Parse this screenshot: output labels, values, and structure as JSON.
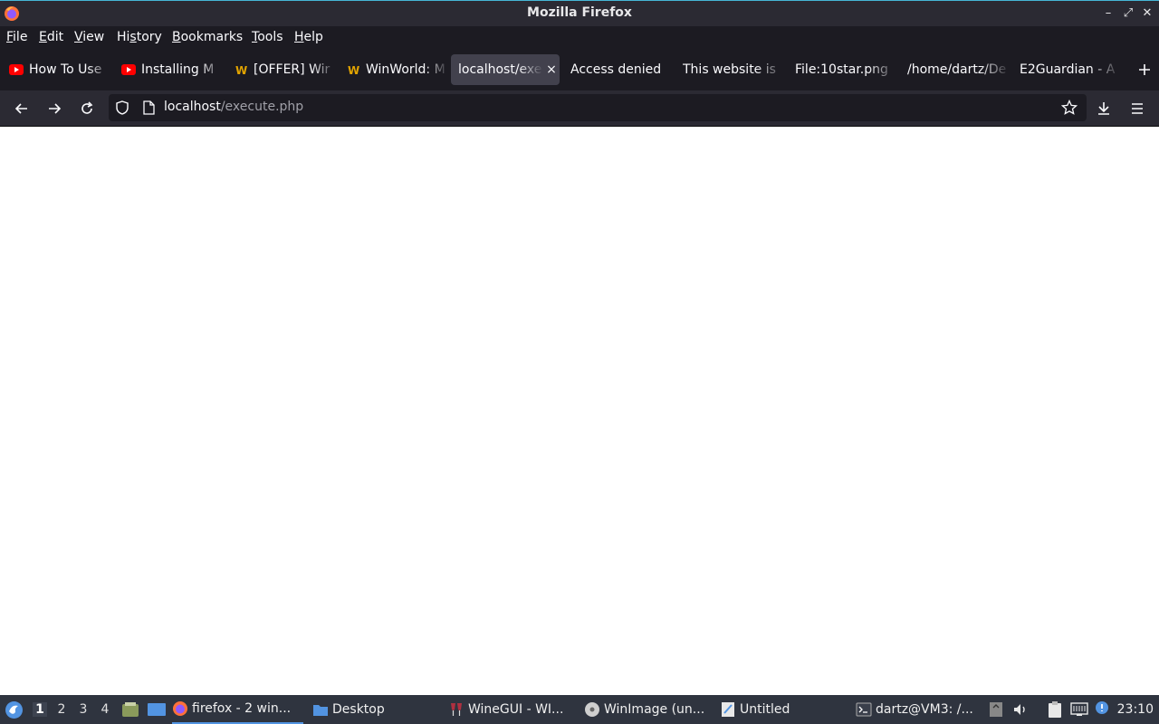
{
  "window": {
    "title": "Mozilla Firefox",
    "controls": {
      "minimize": "–",
      "maximize": "⤢",
      "close": "✕"
    }
  },
  "menu": {
    "items": [
      {
        "label": "File"
      },
      {
        "label": "Edit"
      },
      {
        "label": "View"
      },
      {
        "label": "History"
      },
      {
        "label": "Bookmarks"
      },
      {
        "label": "Tools"
      },
      {
        "label": "Help"
      }
    ]
  },
  "tabs": [
    {
      "label": "How To Use",
      "favicon": "youtube-icon",
      "active": false
    },
    {
      "label": "Installing M",
      "favicon": "youtube-icon",
      "active": false
    },
    {
      "label": "[OFFER] Wir",
      "favicon": "winworld-icon",
      "active": false
    },
    {
      "label": "WinWorld: M",
      "favicon": "winworld-icon",
      "active": false
    },
    {
      "label": "localhost/exe",
      "favicon": "none",
      "active": true
    },
    {
      "label": "Access denied",
      "favicon": "none",
      "active": false
    },
    {
      "label": "This website is",
      "favicon": "none",
      "active": false
    },
    {
      "label": "File:10star.png",
      "favicon": "none",
      "active": false
    },
    {
      "label": "/home/dartz/De",
      "favicon": "none",
      "active": false
    },
    {
      "label": "E2Guardian - A",
      "favicon": "none",
      "active": false
    }
  ],
  "tab_close_glyph": "×",
  "address": {
    "host": "localhost",
    "path": "/execute.php"
  },
  "taskbar": {
    "workspaces": [
      "1",
      "2",
      "3",
      "4"
    ],
    "current_workspace": "1",
    "tasks": [
      {
        "label": "firefox - 2 win...",
        "icon": "firefox-icon",
        "active": true
      },
      {
        "label": "Desktop",
        "icon": "folder-icon",
        "active": false
      },
      {
        "label": "WineGUI - WI...",
        "icon": "wine-icon",
        "active": false
      },
      {
        "label": "WinImage (un...",
        "icon": "winimage-icon",
        "active": false
      },
      {
        "label": "Untitled",
        "icon": "text-editor-icon",
        "active": false
      },
      {
        "label": "dartz@VM3: /...",
        "icon": "terminal-icon",
        "active": false
      }
    ],
    "clock": "23:10"
  },
  "colors": {
    "titlebar": "#2b2a33",
    "tabstrip": "#1c1b22",
    "active_tab": "#42414d",
    "taskbar": "#2f343f",
    "accent": "#5294e2"
  }
}
